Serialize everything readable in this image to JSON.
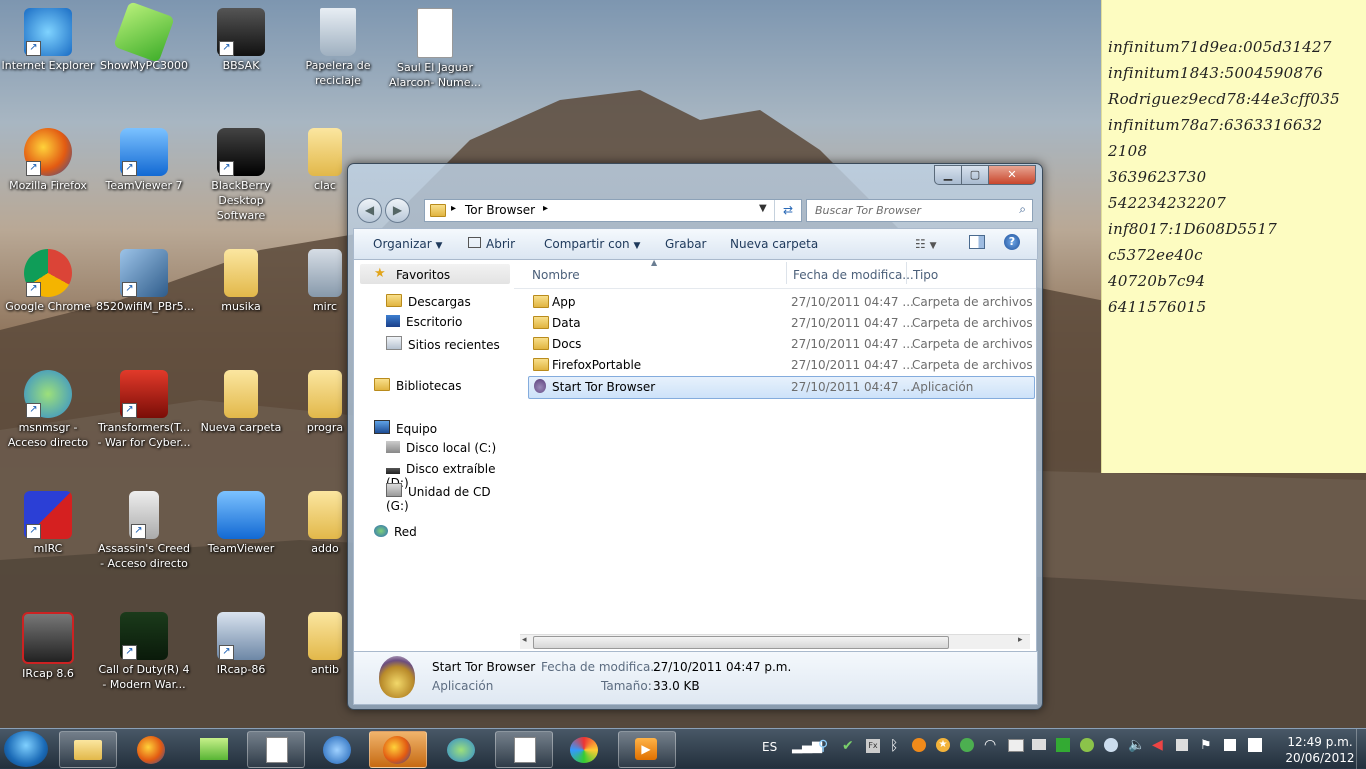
{
  "desktop": {
    "icons": [
      {
        "label": "Internet Explorer"
      },
      {
        "label": "ShowMyPC3000"
      },
      {
        "label": "BBSAK"
      },
      {
        "label": "Papelera de\nreciclaje"
      },
      {
        "label": "Saul El Jaguar\nAlarcon- Nume..."
      },
      {
        "label": "Mozilla Firefox"
      },
      {
        "label": "TeamViewer 7"
      },
      {
        "label": "BlackBerry\nDesktop Software"
      },
      {
        "label": "clac"
      },
      {
        "label": "Google Chrome"
      },
      {
        "label": "8520wifiM_PBr5..."
      },
      {
        "label": "musika"
      },
      {
        "label": "mirc"
      },
      {
        "label": "msnmsgr -\nAcceso directo"
      },
      {
        "label": "Transformers(T...\n- War for Cyber..."
      },
      {
        "label": "Nueva carpeta"
      },
      {
        "label": "progra"
      },
      {
        "label": "mIRC"
      },
      {
        "label": "Assassin's Creed\n- Acceso directo"
      },
      {
        "label": "TeamViewer"
      },
      {
        "label": "addo"
      },
      {
        "label": "IRcap 8.6"
      },
      {
        "label": "Call of Duty(R) 4\n- Modern War..."
      },
      {
        "label": "IRcap-86"
      },
      {
        "label": "antib"
      }
    ]
  },
  "sticky_note": {
    "lines": [
      "infinitum71d9ea:005d31427",
      "infinitum1843:5004590876",
      "Rodriguez9ecd78:44e3cff035",
      "infinitum78a7:6363316632",
      "2108",
      "3639623730",
      "542234232207",
      "inf8017:1D608D5517",
      "c5372ee40c",
      "40720b7c94",
      "6411576015"
    ]
  },
  "explorer": {
    "address": "Tor Browser",
    "search_placeholder": "Buscar Tor Browser",
    "toolbar": {
      "organize": "Organizar",
      "open": "Abrir",
      "share": "Compartir con",
      "burn": "Grabar",
      "new_folder": "Nueva carpeta"
    },
    "nav": {
      "favorites": "Favoritos",
      "downloads": "Descargas",
      "desktop": "Escritorio",
      "recent": "Sitios recientes",
      "libraries": "Bibliotecas",
      "computer": "Equipo",
      "disk_c": "Disco local (C:)",
      "disk_d": "Disco extraíble (D:)",
      "disk_g": "Unidad de CD (G:)",
      "network": "Red"
    },
    "columns": {
      "name": "Nombre",
      "date": "Fecha de modifica...",
      "type": "Tipo"
    },
    "files": [
      {
        "name": "App",
        "date": "27/10/2011 04:47 ...",
        "type": "Carpeta de archivos"
      },
      {
        "name": "Data",
        "date": "27/10/2011 04:47 ...",
        "type": "Carpeta de archivos"
      },
      {
        "name": "Docs",
        "date": "27/10/2011 04:47 ...",
        "type": "Carpeta de archivos"
      },
      {
        "name": "FirefoxPortable",
        "date": "27/10/2011 04:47 ...",
        "type": "Carpeta de archivos"
      },
      {
        "name": "Start Tor Browser",
        "date": "27/10/2011 04:47 ...",
        "type": "Aplicación"
      }
    ],
    "details": {
      "name": "Start Tor Browser",
      "kind": "Aplicación",
      "date_label": "Fecha de modifica...",
      "date_value": "27/10/2011 04:47 p.m.",
      "size_label": "Tamaño:",
      "size_value": "33.0 KB"
    }
  },
  "taskbar": {
    "language": "ES",
    "time": "12:49 p.m.",
    "date": "20/06/2012"
  }
}
